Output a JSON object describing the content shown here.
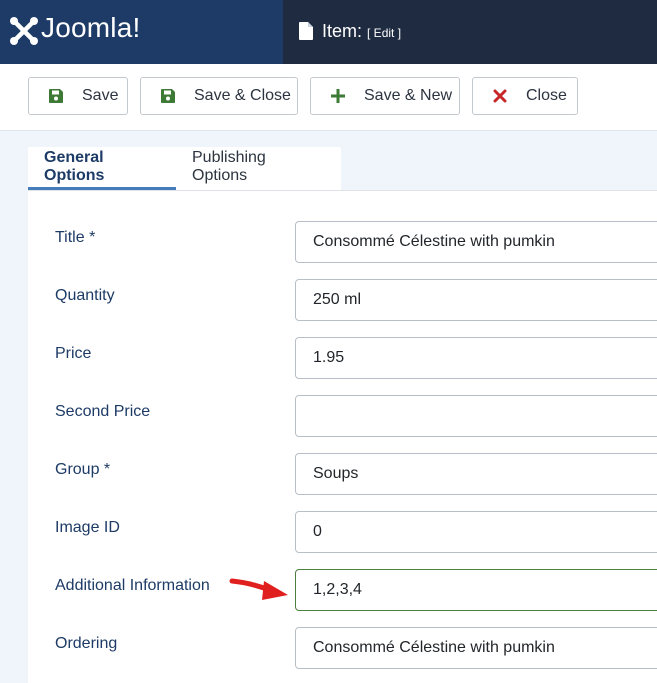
{
  "header": {
    "brand": "Joomla!",
    "page_title": "Item:",
    "page_subtitle": "[ Edit ]"
  },
  "toolbar": {
    "save_label": "Save",
    "save_close_label": "Save & Close",
    "save_new_label": "Save & New",
    "close_label": "Close"
  },
  "tabs": {
    "general": "General Options",
    "publishing": "Publishing Options"
  },
  "form": {
    "fields": [
      {
        "label": "Title *",
        "value": "Consommé Célestine with pumkin"
      },
      {
        "label": "Quantity",
        "value": "250 ml"
      },
      {
        "label": "Price",
        "value": "1.95"
      },
      {
        "label": "Second Price",
        "value": ""
      },
      {
        "label": "Group *",
        "value": "Soups"
      },
      {
        "label": "Image ID",
        "value": "0"
      },
      {
        "label": "Additional Information",
        "value": "1,2,3,4"
      },
      {
        "label": "Ordering",
        "value": "Consommé Célestine with pumkin"
      }
    ]
  },
  "colors": {
    "header_bg": "#1e2b40",
    "brand_bg": "#1d3b66",
    "tab_accent": "#457dba",
    "save_icon": "#3d7a36",
    "close_icon": "#c52827",
    "annotation_arrow": "#e01f1f"
  },
  "icons": {
    "brand": "joomla-logo",
    "page": "document-icon",
    "save": "floppy-disk-icon",
    "save_new": "plus-icon",
    "close": "x-icon"
  }
}
